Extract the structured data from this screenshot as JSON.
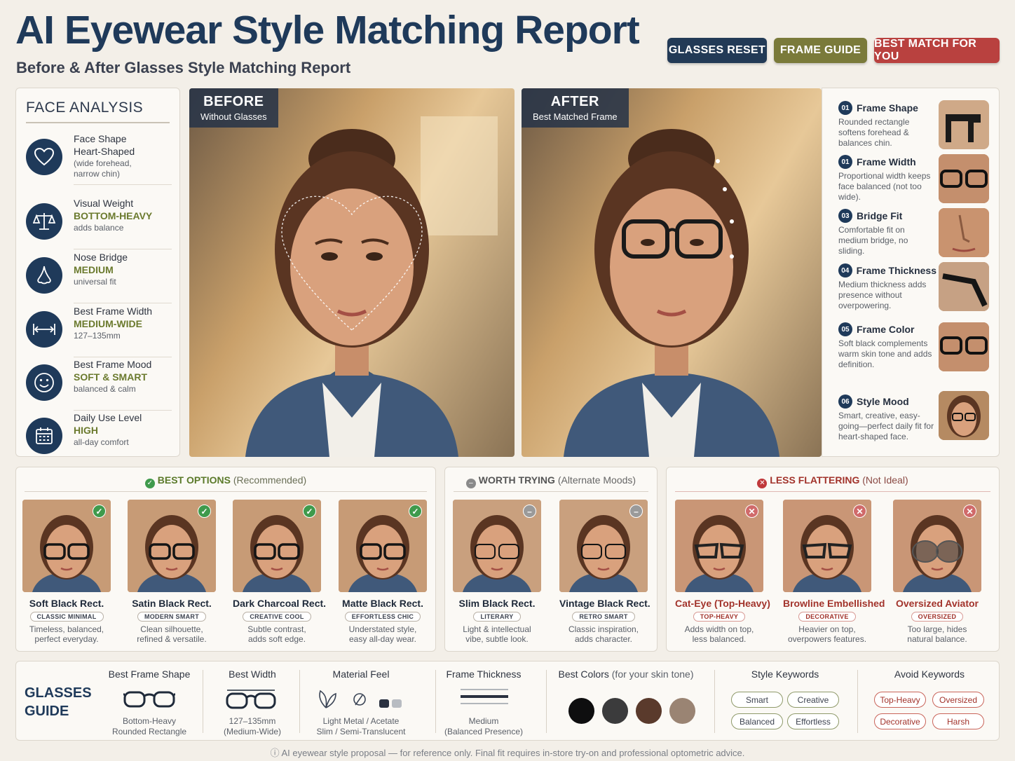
{
  "header": {
    "title": "AI Eyewear Style Matching Report",
    "subtitle": "Before & After Glasses Style Matching Report",
    "buttons": [
      {
        "label": "GLASSES RESET",
        "color": "#223a56"
      },
      {
        "label": "FRAME GUIDE",
        "color": "#7a7a3a"
      },
      {
        "label": "BEST MATCH FOR YOU",
        "color": "#b9413f"
      }
    ]
  },
  "face_analysis": {
    "title": "FACE ANALYSIS",
    "items": [
      {
        "icon": "heart-icon",
        "label": "Face Shape",
        "value": "Heart-Shaped",
        "detail": "(wide forehead,\nnarrow chin)"
      },
      {
        "icon": "balance-scale-icon",
        "label": "Visual Weight",
        "value": "BOTTOM-HEAVY",
        "detail": "adds balance"
      },
      {
        "icon": "nose-icon",
        "label": "Nose Bridge",
        "value": "MEDIUM",
        "detail": "universal fit"
      },
      {
        "icon": "width-arrows-icon",
        "label": "Best Frame Width",
        "value": "MEDIUM-WIDE",
        "detail": "127–135mm"
      },
      {
        "icon": "smile-icon",
        "label": "Best Frame Mood",
        "value": "SOFT & SMART",
        "detail": "balanced & calm"
      },
      {
        "icon": "calendar-icon",
        "label": "Daily Use Level",
        "value": "HIGH",
        "detail": "all-day comfort"
      }
    ]
  },
  "before": {
    "label": "BEFORE",
    "sub": "Without Glasses"
  },
  "after": {
    "label": "AFTER",
    "sub": "Best Matched Frame"
  },
  "details": [
    {
      "num": "01",
      "title": "Frame Shape",
      "text": "Rounded rectangle softens forehead & balances chin."
    },
    {
      "num": "01",
      "title": "Frame Width",
      "text": "Proportional width keeps face balanced (not too wide)."
    },
    {
      "num": "03",
      "title": "Bridge Fit",
      "text": "Comfortable fit on medium bridge, no sliding."
    },
    {
      "num": "04",
      "title": "Frame Thickness",
      "text": "Medium thickness adds presence without overpowering."
    },
    {
      "num": "05",
      "title": "Frame Color",
      "text": "Soft black complements warm skin tone and adds definition."
    },
    {
      "num": "06",
      "title": "Style Mood",
      "text": "Smart, creative, easy-going—perfect daily fit for heart-shaped face."
    }
  ],
  "best_options": {
    "title": "BEST OPTIONS",
    "note": "(Recommended)",
    "cards": [
      {
        "name": "Soft Black Rect.",
        "tag": "CLASSIC MINIMAL",
        "desc": "Timeless, balanced,\nperfect everyday."
      },
      {
        "name": "Satin Black Rect.",
        "tag": "MODERN SMART",
        "desc": "Clean silhouette,\nrefined & versatile."
      },
      {
        "name": "Dark Charcoal Rect.",
        "tag": "CREATIVE COOL",
        "desc": "Subtle contrast,\nadds soft edge."
      },
      {
        "name": "Matte Black Rect.",
        "tag": "EFFORTLESS CHIC",
        "desc": "Understated style,\neasy all-day wear."
      }
    ]
  },
  "worth_trying": {
    "title": "WORTH TRYING",
    "note": "(Alternate Moods)",
    "cards": [
      {
        "name": "Slim Black Rect.",
        "tag": "LITERARY",
        "desc": "Light & intellectual\nvibe, subtle look."
      },
      {
        "name": "Vintage Black Rect.",
        "tag": "RETRO SMART",
        "desc": "Classic inspiration,\nadds character."
      }
    ]
  },
  "less_flattering": {
    "title": "LESS FLATTERING",
    "note": "(Not Ideal)",
    "cards": [
      {
        "name": "Cat-Eye (Top-Heavy)",
        "tag": "TOP-HEAVY",
        "desc": "Adds width on top,\nless balanced."
      },
      {
        "name": "Browline Embellished",
        "tag": "DECORATIVE",
        "desc": "Heavier on top,\noverpowers features."
      },
      {
        "name": "Oversized Aviator",
        "tag": "OVERSIZED",
        "desc": "Too large, hides\nnatural balance."
      }
    ]
  },
  "guide": {
    "title": "GLASSES\nGUIDE",
    "shape_head": "Best Frame Shape",
    "shape_text": "Bottom-Heavy\nRounded Rectangle",
    "width_head": "Best Width",
    "width_text": "127–135mm\n(Medium-Wide)",
    "material_head": "Material Feel",
    "material_text": "Light Metal / Acetate\nSlim / Semi-Translucent",
    "thick_head": "Frame Thickness",
    "thick_text": "Medium\n(Balanced Presence)",
    "colors_head": "Best Colors",
    "colors_note": "(for your skin tone)",
    "colors": [
      "#0e0e0f",
      "#3b3b3c",
      "#5a3a2c",
      "#9a8473"
    ],
    "style_head": "Style Keywords",
    "style_kw": [
      "Smart",
      "Creative",
      "Balanced",
      "Effortless"
    ],
    "avoid_head": "Avoid Keywords",
    "avoid_kw": [
      "Top-Heavy",
      "Oversized",
      "Decorative",
      "Harsh"
    ]
  },
  "footer": "AI eyewear style proposal — for reference only. Final fit requires in-store try-on and professional optometric advice."
}
